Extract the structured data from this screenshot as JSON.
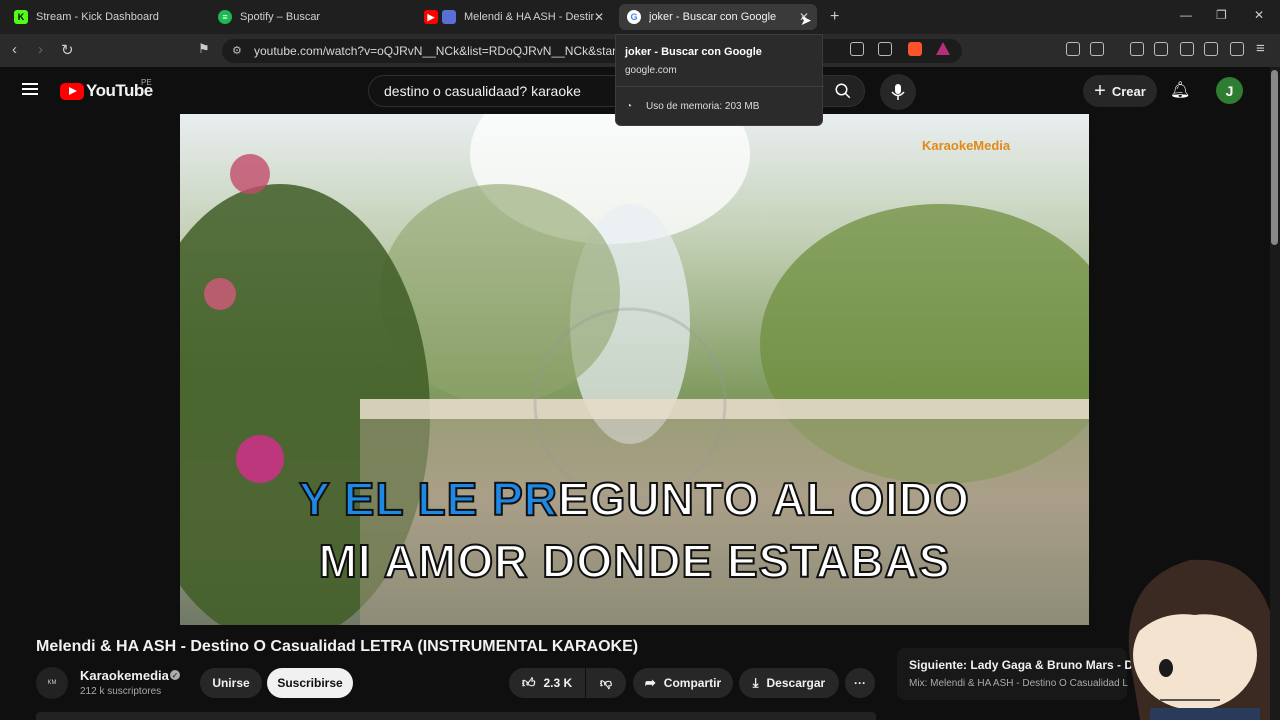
{
  "browser": {
    "tabs": [
      {
        "title": "Stream - Kick Dashboard",
        "icon": "kick-icon",
        "color": "#53fc18"
      },
      {
        "title": "Spotify – Buscar",
        "icon": "spotify-icon",
        "color": "#1db954"
      },
      {
        "title": "Melendi & HA ASH - Destino",
        "icon": "youtube-icon",
        "color": "#ff0000"
      },
      {
        "title": "joker - Buscar con Google",
        "icon": "google-icon",
        "color": "#4285f4"
      }
    ],
    "url": "youtube.com/watch?v=oQJRvN__NCk&list=RDoQJRvN__NCk&start_ra",
    "tooltip": {
      "title": "joker - Buscar con Google",
      "url": "google.com",
      "memory": "Uso de memoria: 203 MB"
    }
  },
  "youtube": {
    "logo": "YouTube",
    "country": "PE",
    "search_value": "destino o casualidaad? karaoke",
    "create_label": "Crear",
    "avatar_letter": "J"
  },
  "video": {
    "lyric_highlight": "Y EL LE PR",
    "lyric_rest": "EGUNTO AL OIDO",
    "lyric_line2": "MI AMOR DONDE ESTABAS",
    "watermark": "KaraokeMedia",
    "title": "Melendi & HA ASH - Destino O Casualidad LETRA (INSTRUMENTAL KARAOKE)"
  },
  "channel": {
    "name": "Karaokemedia",
    "subscribers": "212 k suscriptores",
    "join_label": "Unirse",
    "subscribe_label": "Suscribirse"
  },
  "actions": {
    "likes": "2.3 K",
    "share_label": "Compartir",
    "download_label": "Descargar"
  },
  "next": {
    "label": "Siguiente:",
    "title": "Lady Gaga & Bruno Mars - D",
    "sub": "Mix: Melendi & HA ASH - Destino O Casualidad L"
  },
  "colors": {
    "accent_red": "#ff0000",
    "lyric_highlight": "#1e88e5"
  }
}
